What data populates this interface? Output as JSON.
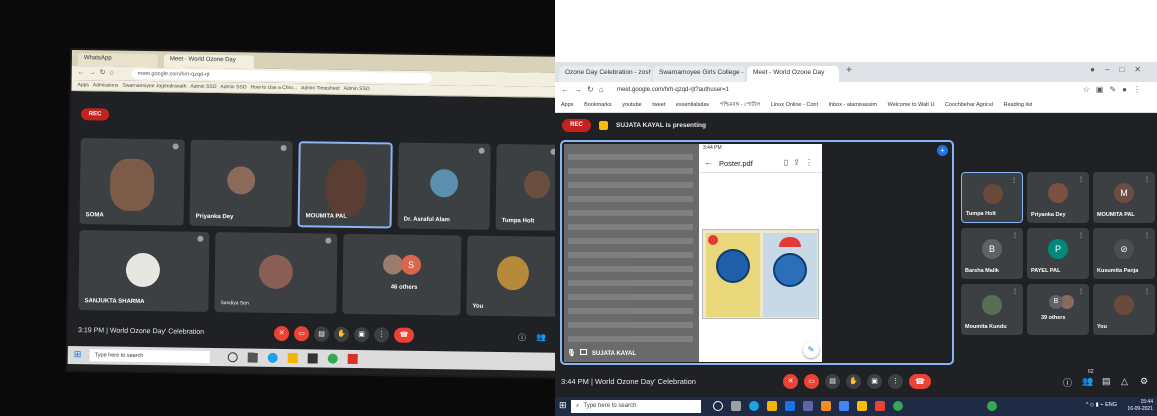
{
  "left": {
    "tabs": [
      "WhatsApp",
      "Meet - World Ozone Day"
    ],
    "url": "meet.google.com/hrh-qzqd-rjt",
    "bookmarks": [
      "Apps",
      "Admissions",
      "Swarnamoyee Jogendranath",
      "Admin SSO",
      "Admin SSO",
      "How to Use a Chro...",
      "Admin Timesheet",
      "Admin SSO"
    ],
    "rec": "REC",
    "tiles": [
      {
        "name": "SOMA"
      },
      {
        "name": "Priyanka Dey"
      },
      {
        "name": "MOUMITA PAL"
      },
      {
        "name": "Dr. Asraful Alam"
      },
      {
        "name": "Tumpa Holt"
      },
      {
        "name": "SANJUKTA SHARMA"
      },
      {
        "name": "Sandiya Sen"
      },
      {
        "name": "46 others"
      },
      {
        "name": "You"
      }
    ],
    "others_initial": "S",
    "meeting": "3:19 PM  |  World Ozone Day' Celebration",
    "taskbar_search": "Type here to search"
  },
  "right": {
    "tabs": [
      "Ozone Day Celebration - zosh",
      "Swarnamoyee Girls College - Cent",
      "Meet - World Ozone Day"
    ],
    "url": "meet.google.com/hrh-qzqd-rjt?authuser=1",
    "bookmarks": [
      "Apps",
      "Bookmarks",
      "youtube",
      "tweet",
      "essentialsdav",
      "পশ্চিমবঙ্গ - পোর্টাল",
      "Linux Online - Cont",
      "Inbox - alamisassim",
      "Welcome to Walt U",
      "Coochbehar Agricul",
      "Reading list"
    ],
    "rec": "REC",
    "presenting": "SUJATA KAYAL is presenting",
    "phone_status": "3:44 PM",
    "doc_title": "Poster.pdf",
    "stage_name": "SUJATA KAYAL",
    "tiles": [
      {
        "name": "Tumpa Holt",
        "type": "photo",
        "highlight": true
      },
      {
        "name": "Priyanka Dey",
        "type": "photo"
      },
      {
        "name": "MOUMITA PAL",
        "type": "letter",
        "letter": "M",
        "color": "#6d4c41"
      },
      {
        "name": "Barsha Malik",
        "type": "letter",
        "letter": "B",
        "color": "#5f6368"
      },
      {
        "name": "PAYEL PAL",
        "type": "letter",
        "letter": "P",
        "color": "#00897b"
      },
      {
        "name": "Kusumita Panja",
        "type": "icon"
      },
      {
        "name": "Moumita Kundu",
        "type": "photo"
      },
      {
        "name": "39 others",
        "type": "group",
        "letter": "B"
      },
      {
        "name": "You",
        "type": "photo"
      }
    ],
    "meeting": "3:44 PM  |  World Ozone Day' Celebration",
    "participant_count": "62",
    "taskbar_search": "Type here to search",
    "clock_time": "15:44",
    "clock_date": "16-09-2021",
    "tray_lang": "ENG"
  },
  "colors": {
    "end_call": "#ea4335",
    "rec": "#c5221f",
    "highlight": "#8ab4f8"
  }
}
